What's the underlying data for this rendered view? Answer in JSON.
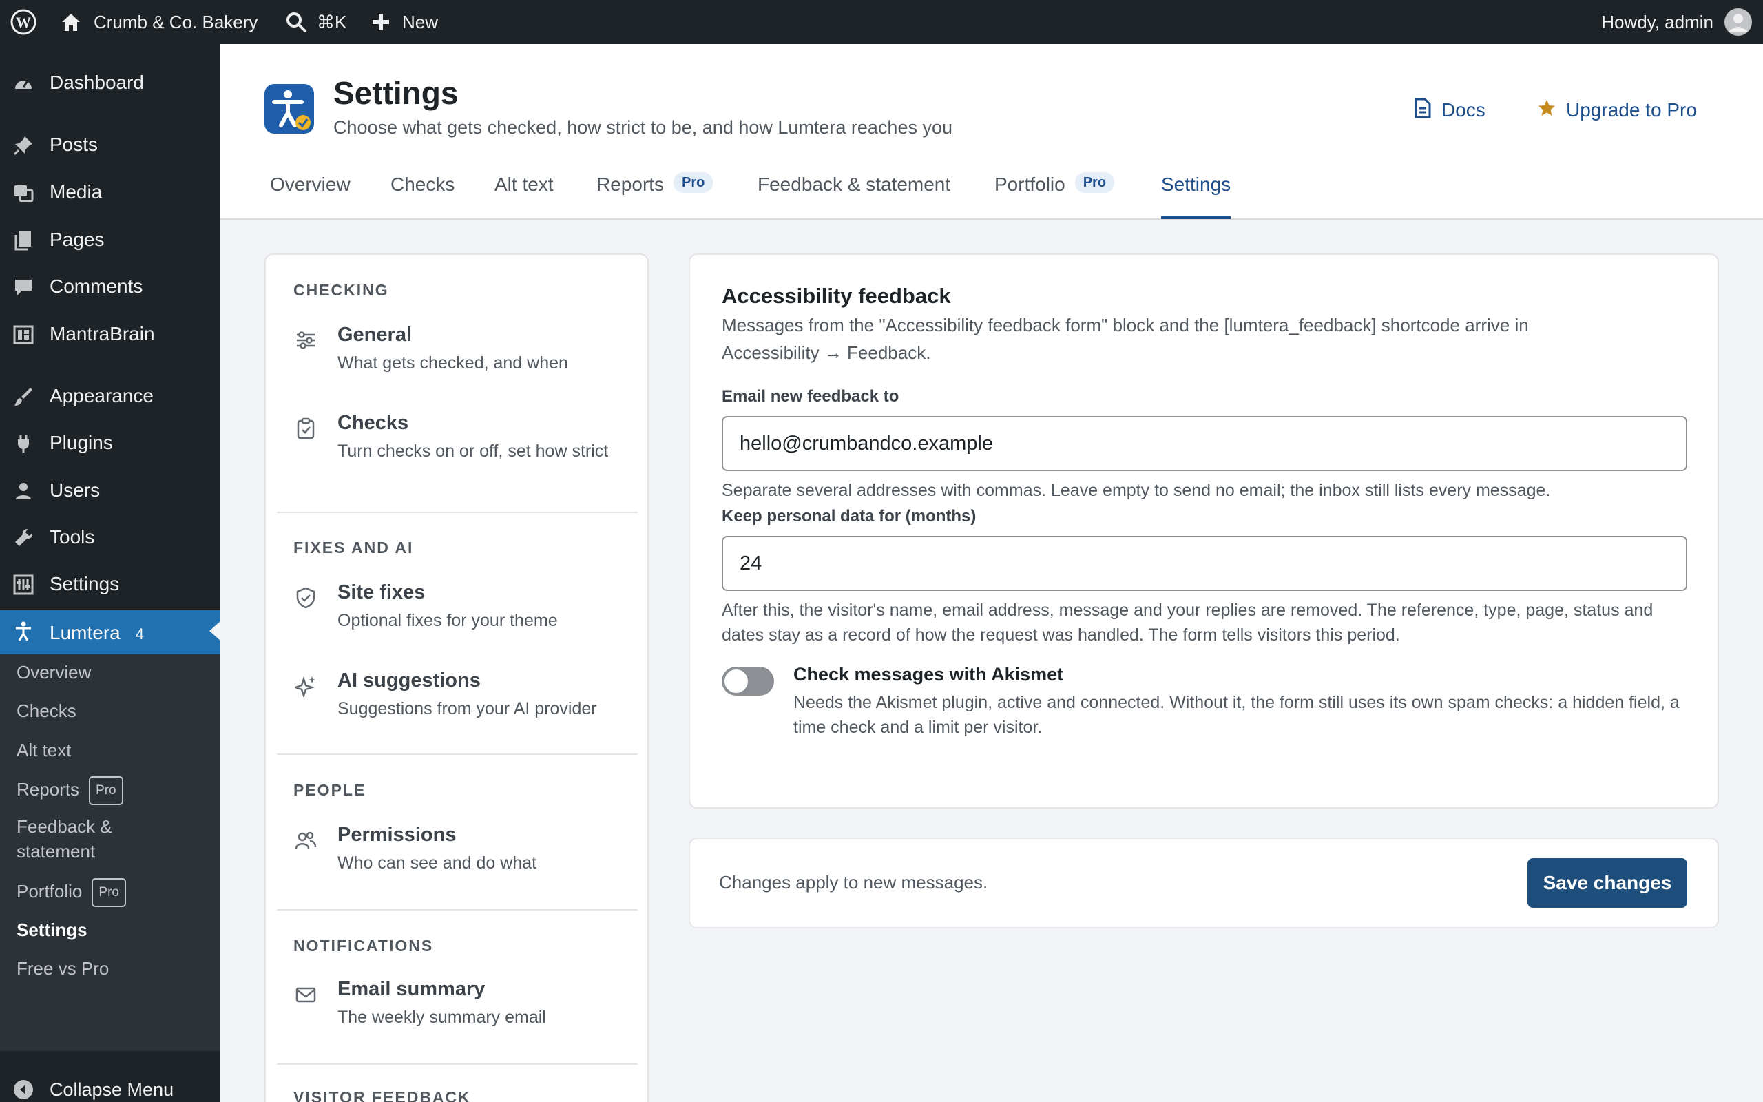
{
  "adminbar": {
    "site_name": "Crumb & Co. Bakery",
    "search_shortcut": "⌘K",
    "new_label": "New",
    "howdy": "Howdy, admin",
    "icons": [
      "wordpress-logo-icon",
      "home-icon",
      "search-icon",
      "plus-icon",
      "avatar-icon"
    ]
  },
  "sidebar": {
    "items": [
      {
        "label": "Dashboard",
        "icon": "dashboard-icon"
      },
      {
        "label": "Posts",
        "icon": "pin-icon"
      },
      {
        "label": "Media",
        "icon": "media-icon"
      },
      {
        "label": "Pages",
        "icon": "pages-icon"
      },
      {
        "label": "Comments",
        "icon": "comment-icon"
      },
      {
        "label": "MantraBrain",
        "icon": "brain-icon"
      },
      {
        "label": "Appearance",
        "icon": "brush-icon"
      },
      {
        "label": "Plugins",
        "icon": "plug-icon"
      },
      {
        "label": "Users",
        "icon": "user-icon"
      },
      {
        "label": "Tools",
        "icon": "wrench-icon"
      },
      {
        "label": "Settings",
        "icon": "settings-icon"
      },
      {
        "label": "Lumtera",
        "icon": "accessibility-icon",
        "count": "4"
      }
    ],
    "submenu": [
      {
        "label": "Overview"
      },
      {
        "label": "Checks"
      },
      {
        "label": "Alt text"
      },
      {
        "label": "Reports",
        "badge": "Pro"
      },
      {
        "label": "Feedback &",
        "label2": "statement"
      },
      {
        "label": "Portfolio",
        "badge": "Pro"
      },
      {
        "label": "Settings"
      },
      {
        "label": "Free vs Pro"
      }
    ],
    "collapse_label": "Collapse Menu"
  },
  "header": {
    "title": "Settings",
    "subtitle": "Choose what gets checked, how strict to be, and how Lumtera reaches you",
    "docs_label": "Docs",
    "upgrade_label": "Upgrade to Pro"
  },
  "tabs": [
    {
      "label": "Overview"
    },
    {
      "label": "Checks"
    },
    {
      "label": "Alt text"
    },
    {
      "label": "Reports",
      "badge": "Pro"
    },
    {
      "label": "Feedback & statement"
    },
    {
      "label": "Portfolio",
      "badge": "Pro"
    },
    {
      "label": "Settings"
    }
  ],
  "settings_nav": {
    "sections": [
      {
        "heading": "CHECKING",
        "items": [
          {
            "title": "General",
            "desc": "What gets checked, and when",
            "icon": "sliders-icon"
          },
          {
            "title": "Checks",
            "desc": "Turn checks on or off, set how strict",
            "icon": "clipboard-check-icon"
          }
        ]
      },
      {
        "heading": "FIXES AND AI",
        "items": [
          {
            "title": "Site fixes",
            "desc": "Optional fixes for your theme",
            "icon": "shield-check-icon"
          },
          {
            "title": "AI suggestions",
            "desc": "Suggestions from your AI provider",
            "icon": "sparkle-icon"
          }
        ]
      },
      {
        "heading": "PEOPLE",
        "items": [
          {
            "title": "Permissions",
            "desc": "Who can see and do what",
            "icon": "people-icon"
          }
        ]
      },
      {
        "heading": "NOTIFICATIONS",
        "items": [
          {
            "title": "Email summary",
            "desc": "The weekly summary email",
            "icon": "mail-icon"
          }
        ]
      },
      {
        "heading": "VISITOR FEEDBACK",
        "items": []
      }
    ]
  },
  "feedback": {
    "title": "Accessibility feedback",
    "desc": "Messages from the \"Accessibility feedback form\" block and the [lumtera_feedback] shortcode arrive in Accessibility → Feedback.",
    "email_label": "Email new feedback to",
    "email_value": "hello@crumbandco.example",
    "email_help": "Separate several addresses with commas. Leave empty to send no email; the inbox still lists every message.",
    "retention_label": "Keep personal data for (months)",
    "retention_value": "24",
    "retention_help": "After this, the visitor's name, email address, message and your replies are removed. The reference, type, page, status and dates stay as a record of how the request was handled. The form tells visitors this period.",
    "akismet_title": "Check messages with Akismet",
    "akismet_desc": "Needs the Akismet plugin, active and connected. Without it, the form still uses its own spam checks: a hidden field, a time check and a limit per visitor.",
    "akismet_enabled": false
  },
  "savebar": {
    "note": "Changes apply to new messages.",
    "save_label": "Save changes"
  },
  "colors": {
    "accent": "#1e4e8c",
    "admin_bar": "#1d2327",
    "active_menu": "#2271b1",
    "badge_bg": "#e6eef8",
    "upgrade_star": "#c68a1d"
  }
}
